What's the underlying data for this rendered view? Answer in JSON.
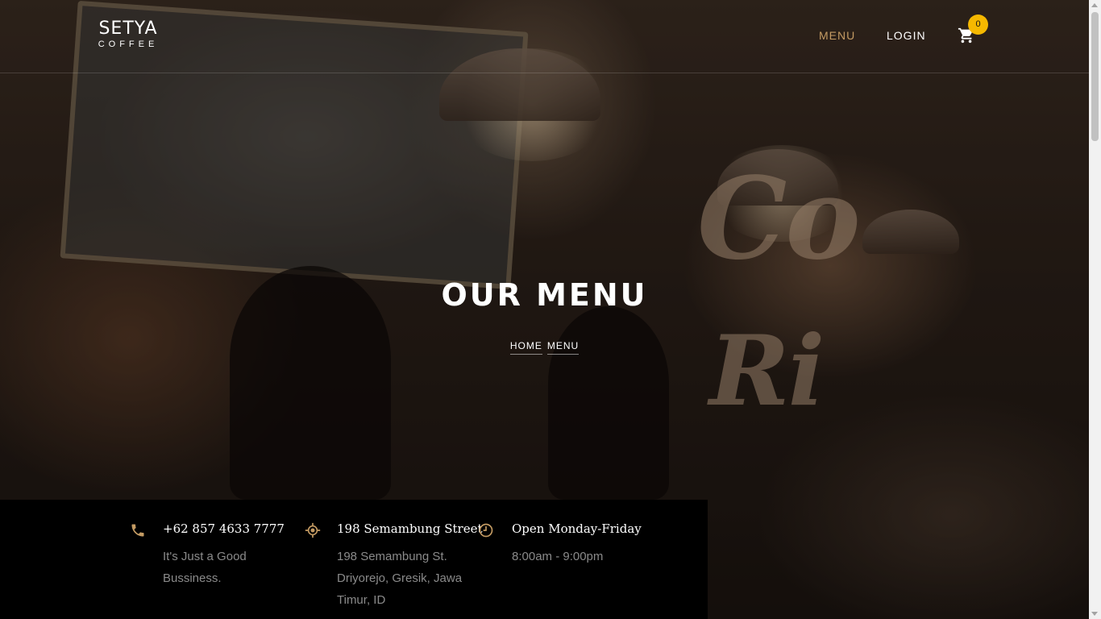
{
  "brand": {
    "name": "SETYA",
    "tagline": "COFFEE"
  },
  "nav": {
    "items": [
      {
        "label": "MENU",
        "active": true
      },
      {
        "label": "LOGIN",
        "active": false
      }
    ],
    "cart": {
      "icon": "cart-icon",
      "count": "0"
    }
  },
  "hero": {
    "title": "OUR MENU",
    "breadcrumb": [
      "HOME",
      "MENU"
    ]
  },
  "info": [
    {
      "icon": "phone-icon",
      "title": "+62 857 4633 7777",
      "text": "It's Just a Good Bussiness."
    },
    {
      "icon": "location-icon",
      "title": "198 Semambung Street",
      "text": "198 Semambung St. Driyorejo, Gresik, Jawa Timur, ID"
    },
    {
      "icon": "clock-icon",
      "title": "Open Monday-Friday",
      "text": "8:00am - 9:00pm"
    }
  ],
  "colors": {
    "accent": "#c49b63",
    "badge": "#f5b800",
    "infoBg": "#000000"
  }
}
